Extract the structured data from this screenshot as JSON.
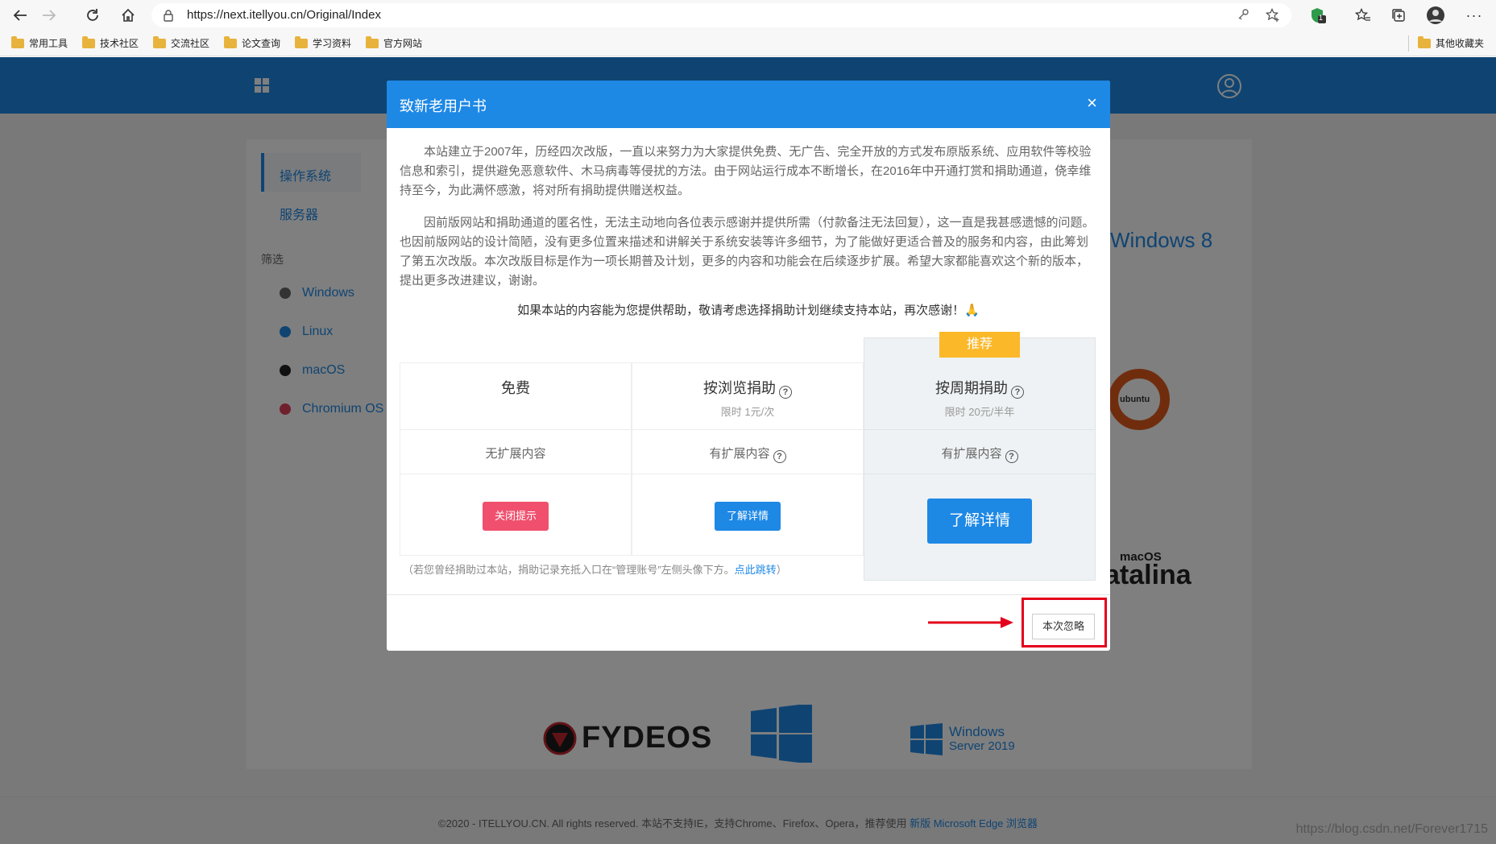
{
  "browser": {
    "url": "https://next.itellyou.cn/Original/Index",
    "shield_badge": "1",
    "bookmarks": [
      "常用工具",
      "技术社区",
      "交流社区",
      "论文查询",
      "学习资料",
      "官方网站"
    ],
    "other_bookmarks": "其他收藏夹"
  },
  "sidebar": {
    "items": [
      {
        "label": "操作系统",
        "active": true
      },
      {
        "label": "服务器",
        "active": false
      }
    ],
    "filter_title": "筛选",
    "filters": [
      {
        "label": "Windows",
        "color": "#666666"
      },
      {
        "label": "Linux",
        "color": "#1e88e5"
      },
      {
        "label": "macOS",
        "color": "#222222"
      },
      {
        "label": "Chromium OS",
        "color": "#e0405a"
      }
    ]
  },
  "background_tiles": {
    "windows8": "Windows 8",
    "ubuntu": "ubuntu",
    "macos_small": "macOS",
    "catalina": "atalina",
    "fydeos": "FYDEOS",
    "winserver_line1": "Windows",
    "winserver_line2": "Server 2019"
  },
  "footer": {
    "text": "©2020 - ITELLYOU.CN. All rights reserved.   本站不支持IE，支持Chrome、Firefox、Opera，推荐使用",
    "link": "新版 Microsoft Edge 浏览器"
  },
  "watermark": "https://blog.csdn.net/Forever1715",
  "modal": {
    "title": "致新老用户书",
    "close": "×",
    "paragraph1": "本站建立于2007年，历经四次改版，一直以来努力为大家提供免费、无广告、完全开放的方式发布原版系统、应用软件等校验信息和索引，提供避免恶意软件、木马病毒等侵扰的方法。由于网站运行成本不断增长，在2016年中开通打赏和捐助通道，侥幸维持至今，为此满怀感激，将对所有捐助提供赠送权益。",
    "paragraph2": "因前版网站和捐助通道的匿名性，无法主动地向各位表示感谢并提供所需（付款备注无法回复），这一直是我甚感遗憾的问题。也因前版网站的设计简陋，没有更多位置来描述和讲解关于系统安装等许多细节，为了能做好更适合普及的服务和内容，由此筹划了第五次改版。本次改版目标是作为一项长期普及计划，更多的内容和功能会在后续逐步扩展。希望大家都能喜欢这个新的版本，提出更多改进建议，谢谢。",
    "thanks": "如果本站的内容能为您提供帮助，敬请考虑选择捐助计划继续支持本站，再次感谢！🙏",
    "plans": [
      {
        "name": "免费",
        "sub": "",
        "feature": "无扩展内容",
        "button": "关闭提示",
        "button_color": "#f0506e"
      },
      {
        "name": "按浏览捐助",
        "sub": "限时 1元/次",
        "feature": "有扩展内容",
        "button": "了解详情",
        "button_color": "#1e88e5"
      },
      {
        "name": "按周期捐助",
        "sub": "限时 20元/半年",
        "feature": "有扩展内容",
        "button": "了解详情",
        "button_color": "#1e88e5",
        "badge": "推荐"
      }
    ],
    "note_prefix": "（若您曾经捐助过本站，捐助记录充抵入口在“管理账号”左侧头像下方。",
    "note_link": "点此跳转",
    "note_suffix": "）",
    "ignore_button": "本次忽略"
  }
}
